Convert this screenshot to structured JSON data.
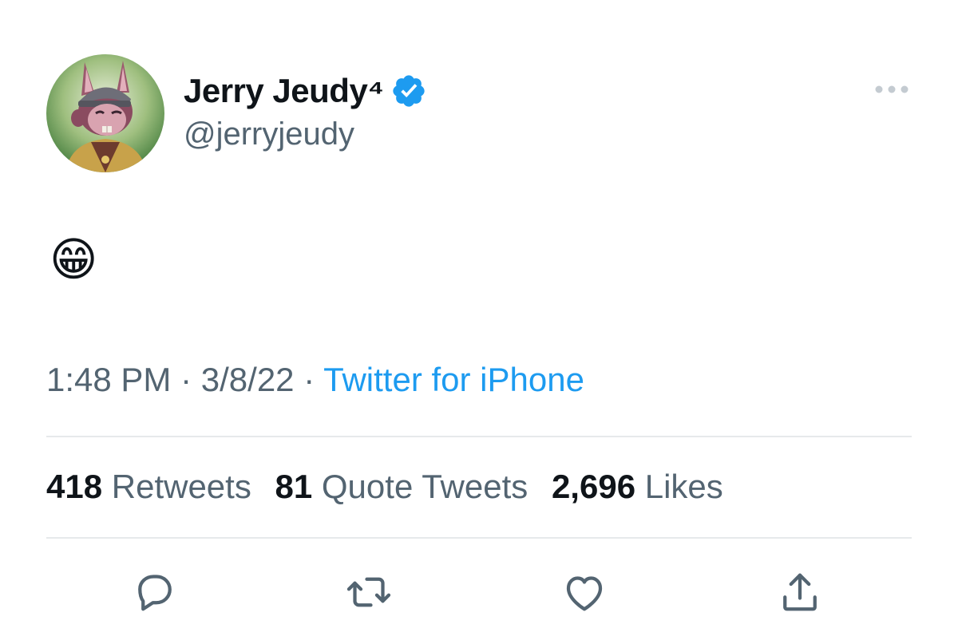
{
  "tweet": {
    "author": {
      "display_name": "Jerry Jeudy⁴",
      "handle": "@jerryjeudy",
      "verified": true
    },
    "body": "😁",
    "meta": {
      "time": "1:48 PM",
      "separator": "·",
      "date": "3/8/22",
      "source": "Twitter for iPhone"
    },
    "stats": {
      "retweets_count": "418",
      "retweets_label": "Retweets",
      "quotes_count": "81",
      "quotes_label": "Quote Tweets",
      "likes_count": "2,696",
      "likes_label": "Likes"
    },
    "icons": {
      "more": "more-horizontal-icon",
      "reply": "reply-icon",
      "retweet": "retweet-icon",
      "like": "heart-icon",
      "share": "share-icon",
      "verified": "verified-badge-icon"
    },
    "colors": {
      "accent": "#1d9bf0",
      "text_primary": "#0f1419",
      "text_secondary": "#536471",
      "divider": "#e6e9eb"
    }
  }
}
